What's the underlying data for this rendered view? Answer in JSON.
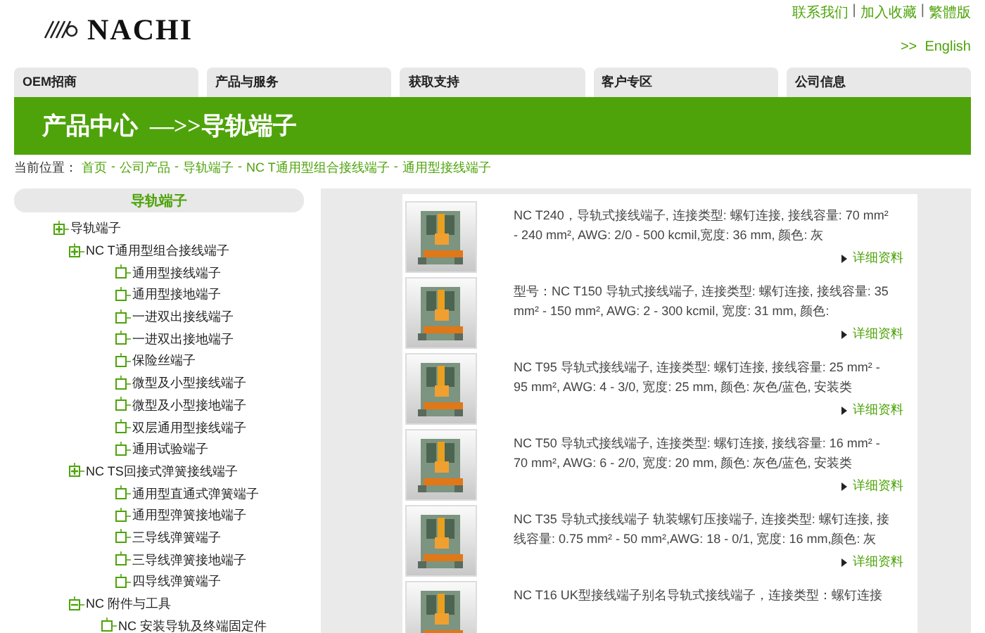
{
  "header": {
    "logo": "NACHI",
    "top_links": [
      "联系我们",
      "加入收藏",
      "繁體版"
    ],
    "link_separator": "|",
    "language_link": ">>  English"
  },
  "nav": {
    "tabs": [
      {
        "label": "OEM招商",
        "selected": false
      },
      {
        "label": "产品与服务",
        "selected": false
      },
      {
        "label": "获取支持",
        "selected": false
      },
      {
        "label": "客户专区",
        "selected": false
      },
      {
        "label": "公司信息",
        "selected": false
      }
    ]
  },
  "banner": {
    "title": "产品中心  —>>导轨端子"
  },
  "breadcrumb": {
    "label": "当前位置：",
    "separator": "-",
    "links": [
      "首页",
      "公司产品",
      "导轨端子",
      "NC T通用型组合接线端子",
      "通用型接线端子"
    ]
  },
  "sidebar": {
    "title": "导轨端子",
    "tree": [
      {
        "label": "导轨端子",
        "kind": "plus",
        "children": [
          {
            "label": "NC T通用型组合接线端子",
            "kind": "plus",
            "children": [
              {
                "label": "通用型接线端子",
                "kind": "leaf"
              },
              {
                "label": "通用型接地端子",
                "kind": "leaf"
              },
              {
                "label": "一进双出接线端子",
                "kind": "leaf"
              },
              {
                "label": "一进双出接地端子",
                "kind": "leaf"
              },
              {
                "label": "保险丝端子",
                "kind": "leaf"
              },
              {
                "label": "微型及小型接线端子",
                "kind": "leaf"
              },
              {
                "label": "微型及小型接地端子",
                "kind": "leaf"
              },
              {
                "label": "双层通用型接线端子",
                "kind": "leaf"
              },
              {
                "label": "通用试验端子",
                "kind": "leaf"
              }
            ]
          },
          {
            "label": "NC TS回接式弹簧接线端子",
            "kind": "plus",
            "children": [
              {
                "label": "通用型直通式弹簧端子",
                "kind": "leaf"
              },
              {
                "label": "通用型弹簧接地端子",
                "kind": "leaf"
              },
              {
                "label": "三导线弹簧端子",
                "kind": "leaf"
              },
              {
                "label": "三导线弹簧接地端子",
                "kind": "leaf"
              },
              {
                "label": "四导线弹簧端子",
                "kind": "leaf"
              }
            ]
          },
          {
            "label": "NC 附件与工具",
            "kind": "minus",
            "children": [
              {
                "label": "NC 安装导轨及终端固定件",
                "kind": "leaf"
              }
            ]
          }
        ]
      }
    ]
  },
  "products": [
    {
      "description": "NC T240，导轨式接线端子, 连接类型: 螺钉连接, 接线容量: 70 mm² - 240 mm², AWG: 2/0 - 500 kcmil,宽度: 36 mm, 颜色: 灰",
      "link": "详细资料"
    },
    {
      "description": "型号：NC T150 导轨式接线端子, 连接类型: 螺钉连接, 接线容量: 35 mm² - 150 mm², AWG: 2 - 300 kcmil, 宽度: 31 mm, 颜色:",
      "link": "详细资料"
    },
    {
      "description": "NC T95 导轨式接线端子, 连接类型: 螺钉连接, 接线容量: 25 mm² - 95 mm², AWG: 4 - 3/0, 宽度: 25 mm, 颜色: 灰色/蓝色, 安装类",
      "link": "详细资料"
    },
    {
      "description": "NC T50 导轨式接线端子, 连接类型: 螺钉连接, 接线容量: 16 mm² - 70 mm², AWG: 6 - 2/0, 宽度: 20 mm, 颜色: 灰色/蓝色, 安装类",
      "link": "详细资料"
    },
    {
      "description": "NC T35 导轨式接线端子 轨装螺钉压接端子, 连接类型: 螺钉连接, 接线容量: 0.75 mm² - 50 mm²,AWG: 18 - 0/1, 宽度: 16 mm,颜色: 灰",
      "link": "详细资料"
    },
    {
      "description": "NC T16 UK型接线端子别名导轨式接线端子，连接类型：螺钉连接"
    }
  ]
}
